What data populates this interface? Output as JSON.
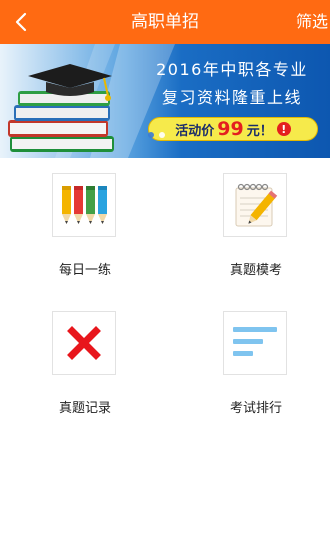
{
  "header": {
    "title": "高职单招",
    "filter_label": "筛选",
    "bg_color": "#ff6a12"
  },
  "banner": {
    "line1": "2016年中职各专业",
    "line2": "复习资料隆重上线",
    "promo_prefix": "活动价",
    "promo_price": "99",
    "promo_suffix": "元！",
    "promo_exclaim": "!",
    "slide_count": 2,
    "active_slide": 1
  },
  "grid": {
    "items": [
      {
        "label": "每日一练",
        "icon": "colored-pencils-icon"
      },
      {
        "label": "真题模考",
        "icon": "notepad-pencil-icon"
      },
      {
        "label": "真题记录",
        "icon": "red-cross-icon"
      },
      {
        "label": "考试排行",
        "icon": "list-lines-icon"
      }
    ]
  }
}
